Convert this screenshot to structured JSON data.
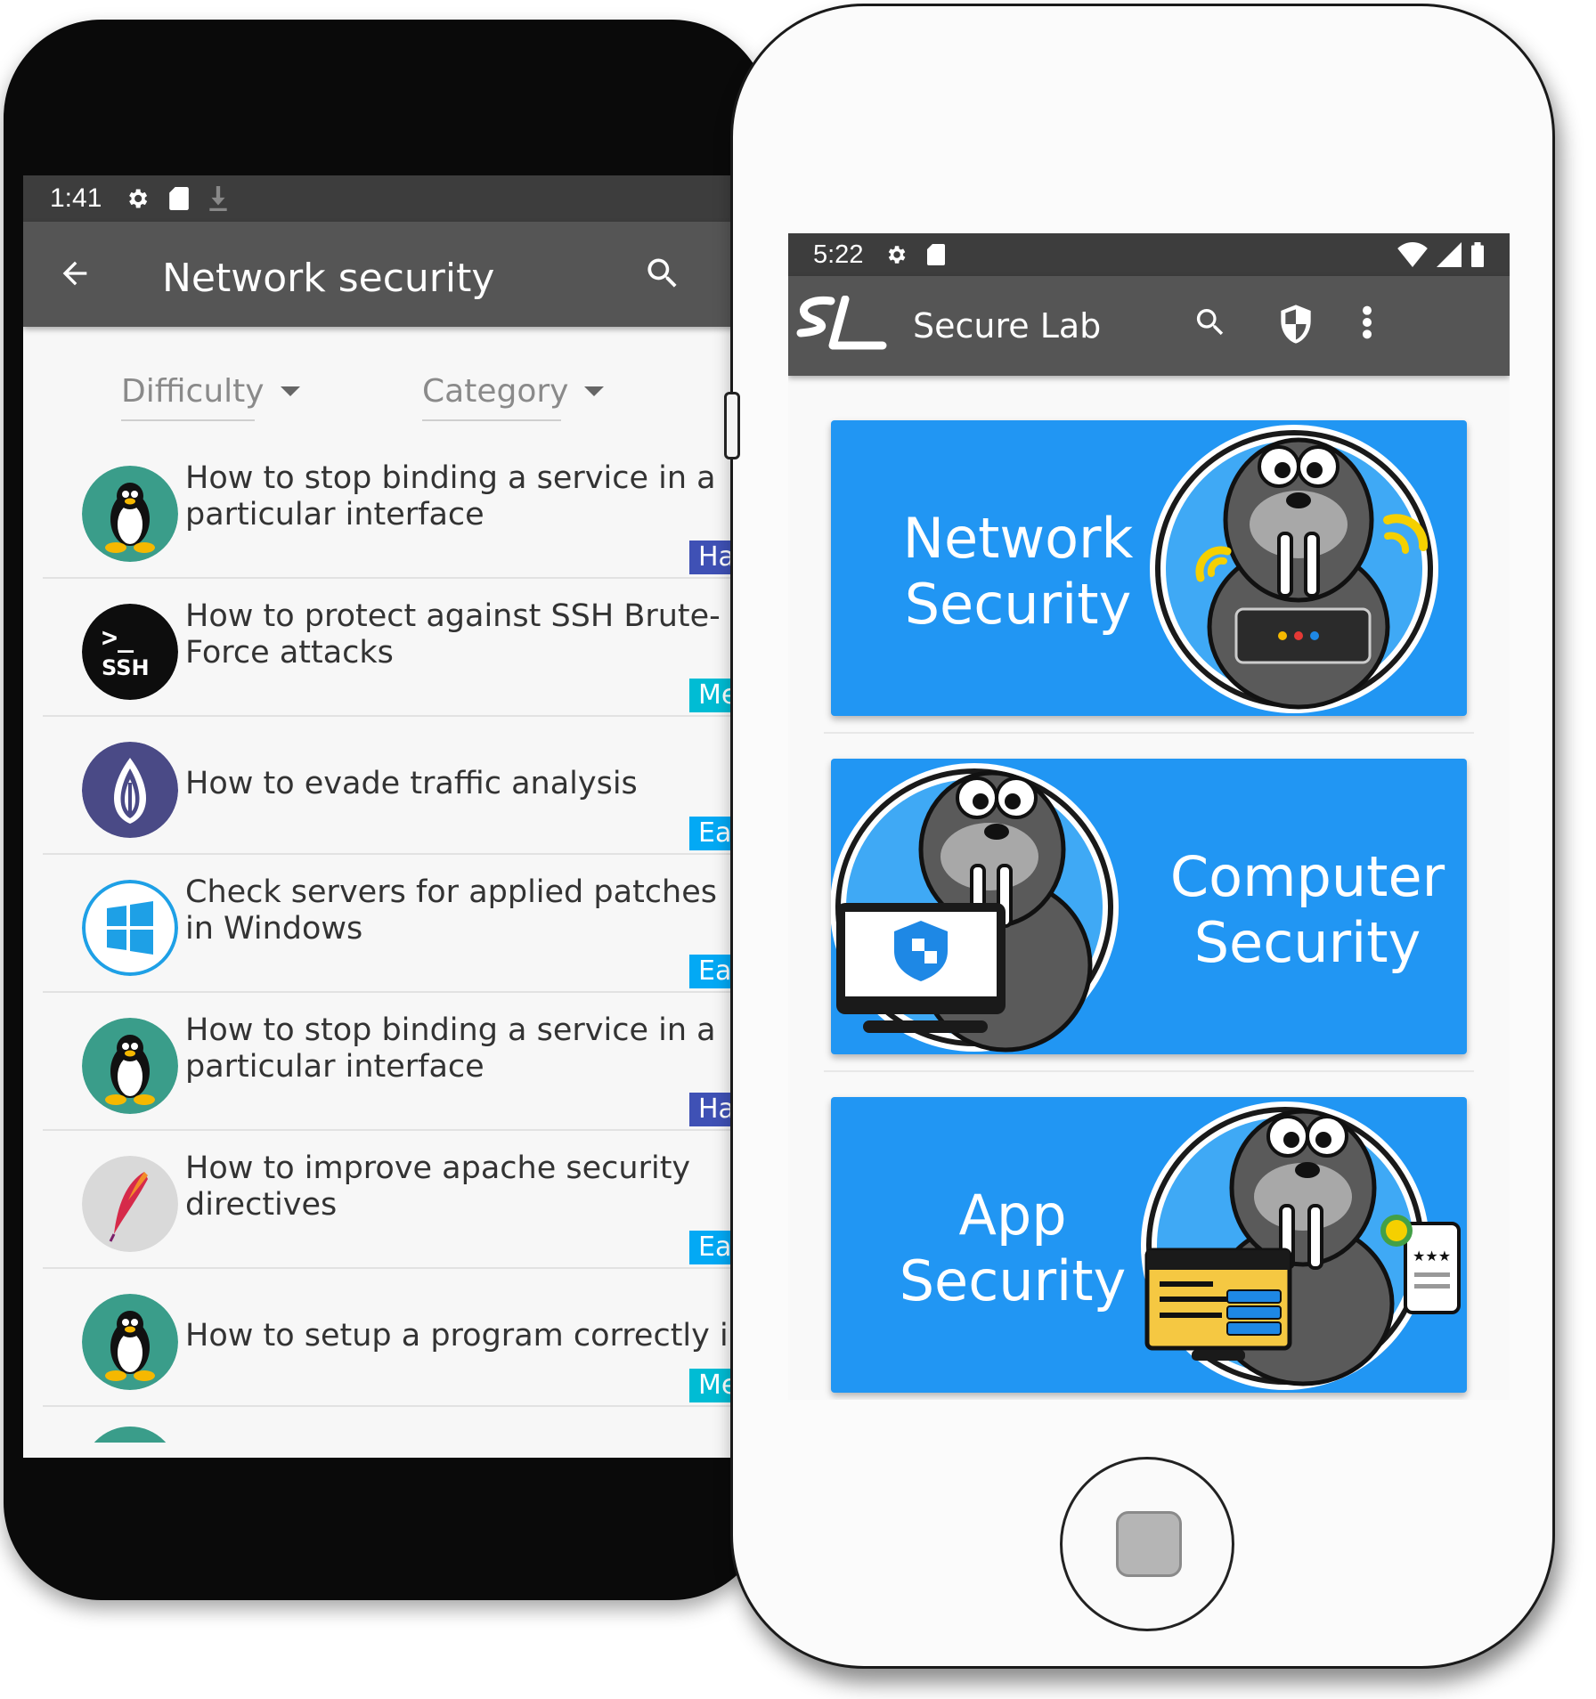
{
  "back_phone": {
    "status": {
      "time": "1:41"
    },
    "appbar": {
      "title": "Network security"
    },
    "filters": {
      "difficulty": "Difficulty",
      "category": "Category"
    },
    "items": [
      {
        "title": "How to stop binding a service in a particular interface",
        "badge": "Ha",
        "icon": "linux-tux-icon"
      },
      {
        "title": "How to protect against SSH Brute-Force attacks",
        "badge": "Med",
        "icon": "ssh-terminal-icon"
      },
      {
        "title": "How to evade traffic analysis",
        "badge": "Eas",
        "icon": "tor-onion-icon"
      },
      {
        "title": "Check servers for applied patches in Windows",
        "badge": "Eas",
        "icon": "windows-icon"
      },
      {
        "title": "How to stop binding a service in a particular interface",
        "badge": "Har",
        "icon": "linux-tux-icon"
      },
      {
        "title": "How to improve apache security directives",
        "badge": "Eas",
        "icon": "apache-feather-icon"
      },
      {
        "title": "How to setup a program correctly in linux",
        "badge": "Medi",
        "icon": "linux-tux-icon"
      }
    ]
  },
  "front_phone": {
    "status": {
      "time": "5:22"
    },
    "appbar": {
      "title": "Secure Lab",
      "logo": "SL"
    },
    "cards": [
      {
        "line1": "Network",
        "line2": "Security"
      },
      {
        "line1": "Computer",
        "line2": "Security"
      },
      {
        "line1": "App",
        "line2": "Security"
      }
    ]
  },
  "colors": {
    "hard": "#3f51b5",
    "medium": "#00bcd4",
    "easy": "#03a9f4",
    "card_blue": "#2196f3",
    "appbar": "#555555"
  }
}
